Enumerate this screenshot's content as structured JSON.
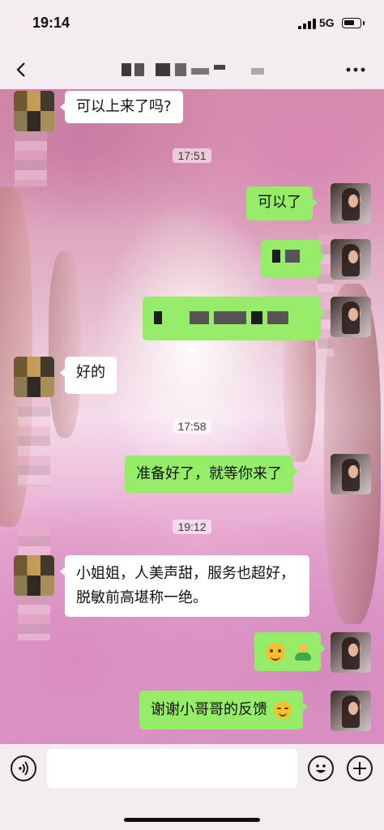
{
  "status_bar": {
    "time": "19:14",
    "network": "5G"
  },
  "header": {
    "title": ""
  },
  "composer": {
    "placeholder": ""
  },
  "messages": [
    {
      "side": "in",
      "text": "可以上来了吗?"
    },
    {
      "type": "time",
      "text": "17:51"
    },
    {
      "side": "out",
      "text": "可以了"
    },
    {
      "side": "out",
      "text": "",
      "redacted": true
    },
    {
      "side": "out",
      "text": "",
      "redacted": true
    },
    {
      "side": "in",
      "text": "好的"
    },
    {
      "type": "time",
      "text": "17:58"
    },
    {
      "side": "out",
      "text": "准备好了，就等你来了"
    },
    {
      "type": "time",
      "text": "19:12"
    },
    {
      "side": "in",
      "text": "小姐姐，人美声甜，服务也超好，脱敏前高堪称一绝。"
    },
    {
      "side": "out",
      "emoji": [
        "hugging-face",
        "seedling-hug"
      ]
    },
    {
      "side": "out",
      "text": "谢谢小哥哥的反馈",
      "emoji": [
        "blush-face"
      ]
    }
  ],
  "colors": {
    "incoming_bubble": "#ffffff",
    "outgoing_bubble": "#95ec69",
    "bar_background": "#f3ecf0"
  },
  "icons": [
    "back-arrow-icon",
    "more-dots-icon",
    "voice-icon",
    "emoji-face-icon",
    "plus-icon"
  ]
}
